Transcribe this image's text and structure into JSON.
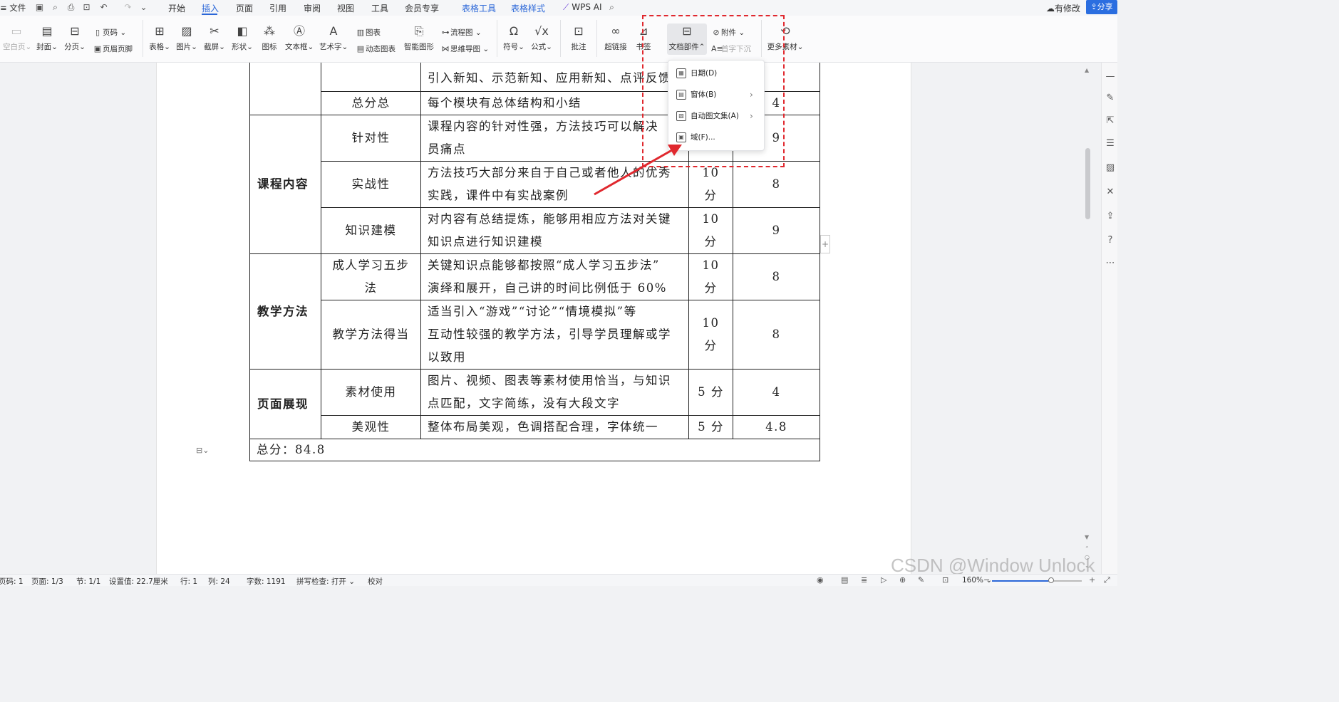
{
  "menubar": {
    "file_label": "文件",
    "tabs": [
      {
        "label": "开始"
      },
      {
        "label": "插入"
      },
      {
        "label": "页面"
      },
      {
        "label": "引用"
      },
      {
        "label": "审阅"
      },
      {
        "label": "视图"
      },
      {
        "label": "工具"
      },
      {
        "label": "会员专享"
      },
      {
        "label": "表格工具"
      },
      {
        "label": "表格样式"
      }
    ],
    "active_tab": "插入",
    "wps_ai_label": "WPS AI",
    "has_changes_label": "有修改",
    "share_label": "分享",
    "accent_color": "#2b67d8"
  },
  "ribbon": {
    "blank_page": "空白页",
    "cover": "封面",
    "page_break": "分页",
    "page_number": "页码",
    "header_footer": "页眉页脚",
    "table": "表格",
    "picture": "图片",
    "screenshot": "截屏",
    "shape": "形状",
    "icon": "图标",
    "textbox": "文本框",
    "wordart": "艺术字",
    "chart": "图表",
    "dynamic_chart": "动态图表",
    "smart_graphic": "智能图形",
    "flowchart": "流程图",
    "mindmap": "思维导图",
    "symbol": "符号",
    "formula": "公式",
    "comment": "批注",
    "hyperlink": "超链接",
    "bookmark": "书签",
    "doc_parts": "文档部件",
    "attachment": "附件",
    "drop_cap": "首字下沉",
    "more_materials": "更多素材"
  },
  "dropdown": {
    "items": [
      {
        "label": "日期(D)",
        "icon": "calendar-icon",
        "has_submenu": false
      },
      {
        "label": "窗体(B)",
        "icon": "form-icon",
        "has_submenu": true
      },
      {
        "label": "自动图文集(A)",
        "icon": "autotext-icon",
        "has_submenu": true
      },
      {
        "label": "域(F)...",
        "icon": "field-icon",
        "has_submenu": false
      }
    ]
  },
  "document": {
    "rows": [
      {
        "category": "",
        "criterion": "",
        "description": [
          "引入新知、示范新知、应用新知、点评反馈"
        ],
        "points": "",
        "score": "",
        "partial_top": true
      },
      {
        "category": "",
        "criterion": "总分总",
        "description": [
          "每个模块有总体结构和小结"
        ],
        "points": "",
        "score": "4"
      },
      {
        "category": "课程内容",
        "criterion": "针对性",
        "description": [
          "课程内容的针对性强，方法技巧可以解决",
          "员痛点"
        ],
        "points": "",
        "score": "9"
      },
      {
        "category": "",
        "criterion": "实战性",
        "description": [
          "方法技巧大部分来自于自己或者他人的优秀",
          "实践，课件中有实战案例"
        ],
        "points": "10 分",
        "score": "8"
      },
      {
        "category": "",
        "criterion": "知识建模",
        "description": [
          "对内容有总结提炼，能够用相应方法对关键",
          "知识点进行知识建模"
        ],
        "points": "10 分",
        "score": "9"
      },
      {
        "category": "教学方法",
        "criterion": "成人学习五步法",
        "description": [
          "关键知识点能够都按照“成人学习五步法”",
          "演绎和展开，自己讲的时间比例低于 60%"
        ],
        "points": "10 分",
        "score": "8"
      },
      {
        "category": "",
        "criterion": "教学方法得当",
        "description": [
          "适当引入“游戏”“讨论”“情境模拟”等",
          "互动性较强的教学方法，引导学员理解或学",
          "以致用"
        ],
        "points": "10 分",
        "score": "8"
      },
      {
        "category": "页面展现",
        "criterion": "素材使用",
        "description": [
          "图片、视频、图表等素材使用恰当，与知识",
          "点匹配，文字简练，没有大段文字"
        ],
        "points": "5 分",
        "score": "4"
      },
      {
        "category": "",
        "criterion": "美观性",
        "description": [
          "整体布局美观，色调搭配合理，字体统一"
        ],
        "points": "5 分",
        "score": "4.8"
      }
    ],
    "category_labels": {
      "content": "课程内容",
      "method": "教学方法",
      "presentation": "页面展现"
    },
    "total_text": "总分：84.8"
  },
  "statusbar": {
    "page_code": "页码: 1",
    "page": "页面: 1/3",
    "section": "节: 1/1",
    "setting_value": "设置值: 22.7厘米",
    "row": "行: 1",
    "column": "列: 24",
    "word_count": "字数: 1191",
    "spell_check": "拼写检查: 打开",
    "proofread": "校对",
    "zoom": "160%",
    "zoom_fraction": 0.66
  },
  "watermark": "CSDN @Window Unlock",
  "annotation_color": "#e0282e"
}
